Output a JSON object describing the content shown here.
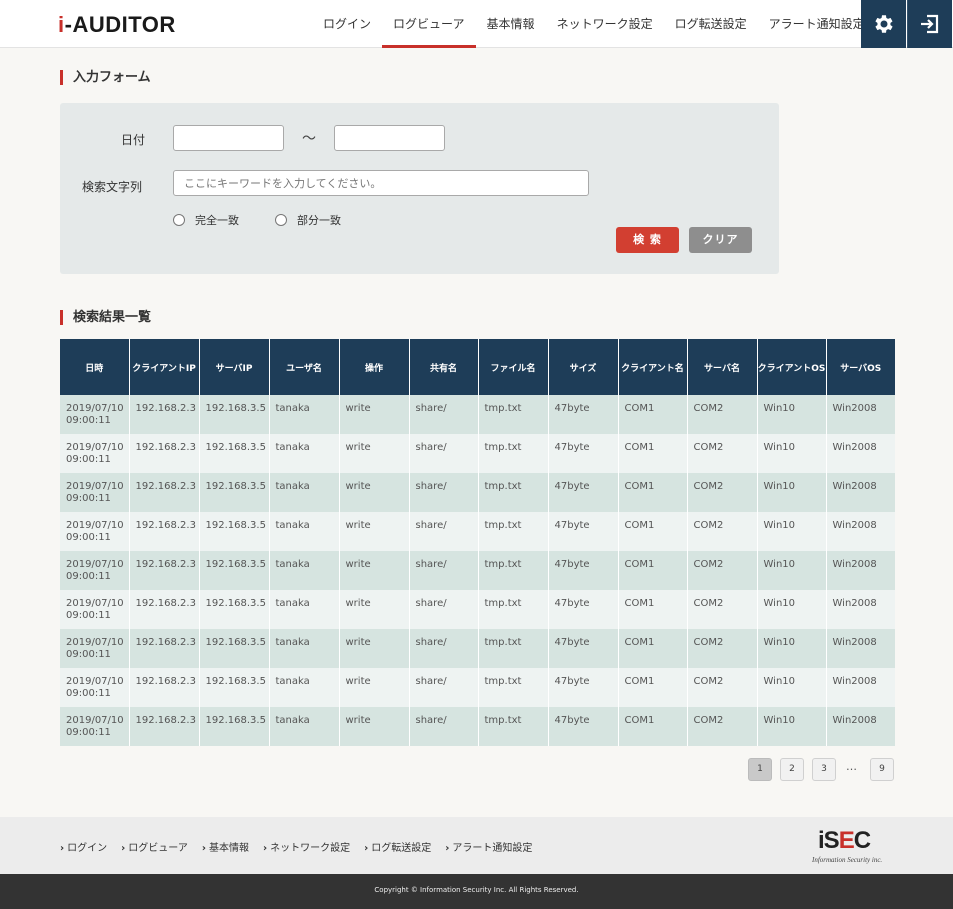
{
  "header": {
    "logo_prefix": "i",
    "logo_text": "-AUDITOR",
    "nav": [
      "ログイン",
      "ログビューア",
      "基本情報",
      "ネットワーク設定",
      "ログ転送設定",
      "アラート通知設定"
    ],
    "active_nav": "ログビューア",
    "settings_icon": "gear-icon",
    "logout_icon": "logout-icon"
  },
  "form": {
    "title": "入力フォーム",
    "date_label": "日付",
    "tilde": "～",
    "date_from": "",
    "date_to": "",
    "keyword_label": "検索文字列",
    "keyword_placeholder": "ここにキーワードを入力してください。",
    "radio_exact": "完全一致",
    "radio_partial": "部分一致",
    "search_button": "検 索",
    "clear_button": "クリア"
  },
  "results": {
    "title": "検索結果一覧",
    "columns": [
      "日時",
      "クライアントIP",
      "サーバIP",
      "ユーザ名",
      "操作",
      "共有名",
      "ファイル名",
      "サイズ",
      "クライアント名",
      "サーバ名",
      "クライアントOS",
      "サーバOS"
    ],
    "rows": [
      [
        "2019/07/10\n09:00:11",
        "192.168.2.3",
        "192.168.3.5",
        "tanaka",
        "write",
        "share/",
        "tmp.txt",
        "47byte",
        "COM1",
        "COM2",
        "Win10",
        "Win2008"
      ],
      [
        "2019/07/10\n09:00:11",
        "192.168.2.3",
        "192.168.3.5",
        "tanaka",
        "write",
        "share/",
        "tmp.txt",
        "47byte",
        "COM1",
        "COM2",
        "Win10",
        "Win2008"
      ],
      [
        "2019/07/10\n09:00:11",
        "192.168.2.3",
        "192.168.3.5",
        "tanaka",
        "write",
        "share/",
        "tmp.txt",
        "47byte",
        "COM1",
        "COM2",
        "Win10",
        "Win2008"
      ],
      [
        "2019/07/10\n09:00:11",
        "192.168.2.3",
        "192.168.3.5",
        "tanaka",
        "write",
        "share/",
        "tmp.txt",
        "47byte",
        "COM1",
        "COM2",
        "Win10",
        "Win2008"
      ],
      [
        "2019/07/10\n09:00:11",
        "192.168.2.3",
        "192.168.3.5",
        "tanaka",
        "write",
        "share/",
        "tmp.txt",
        "47byte",
        "COM1",
        "COM2",
        "Win10",
        "Win2008"
      ],
      [
        "2019/07/10\n09:00:11",
        "192.168.2.3",
        "192.168.3.5",
        "tanaka",
        "write",
        "share/",
        "tmp.txt",
        "47byte",
        "COM1",
        "COM2",
        "Win10",
        "Win2008"
      ],
      [
        "2019/07/10\n09:00:11",
        "192.168.2.3",
        "192.168.3.5",
        "tanaka",
        "write",
        "share/",
        "tmp.txt",
        "47byte",
        "COM1",
        "COM2",
        "Win10",
        "Win2008"
      ],
      [
        "2019/07/10\n09:00:11",
        "192.168.2.3",
        "192.168.3.5",
        "tanaka",
        "write",
        "share/",
        "tmp.txt",
        "47byte",
        "COM1",
        "COM2",
        "Win10",
        "Win2008"
      ],
      [
        "2019/07/10\n09:00:11",
        "192.168.2.3",
        "192.168.3.5",
        "tanaka",
        "write",
        "share/",
        "tmp.txt",
        "47byte",
        "COM1",
        "COM2",
        "Win10",
        "Win2008"
      ]
    ]
  },
  "pagination": {
    "pages": [
      "1",
      "2",
      "3"
    ],
    "dots": "…",
    "last": "9",
    "current": "1"
  },
  "footer": {
    "links": [
      "ログイン",
      "ログビューア",
      "基本情報",
      "ネットワーク設定",
      "ログ転送設定",
      "アラート通知設定"
    ],
    "chevron": "›",
    "brand_main": "iS",
    "brand_accent": "E",
    "brand_end": "C",
    "brand_tagline": "Information Security inc.",
    "copyright": "Copyright © Information Security Inc. All Rights Reserved."
  },
  "colors": {
    "accent_red": "#c8302a",
    "navy": "#1e3d58",
    "row_odd": "#d6e4e0",
    "row_even": "#eef3f2"
  }
}
